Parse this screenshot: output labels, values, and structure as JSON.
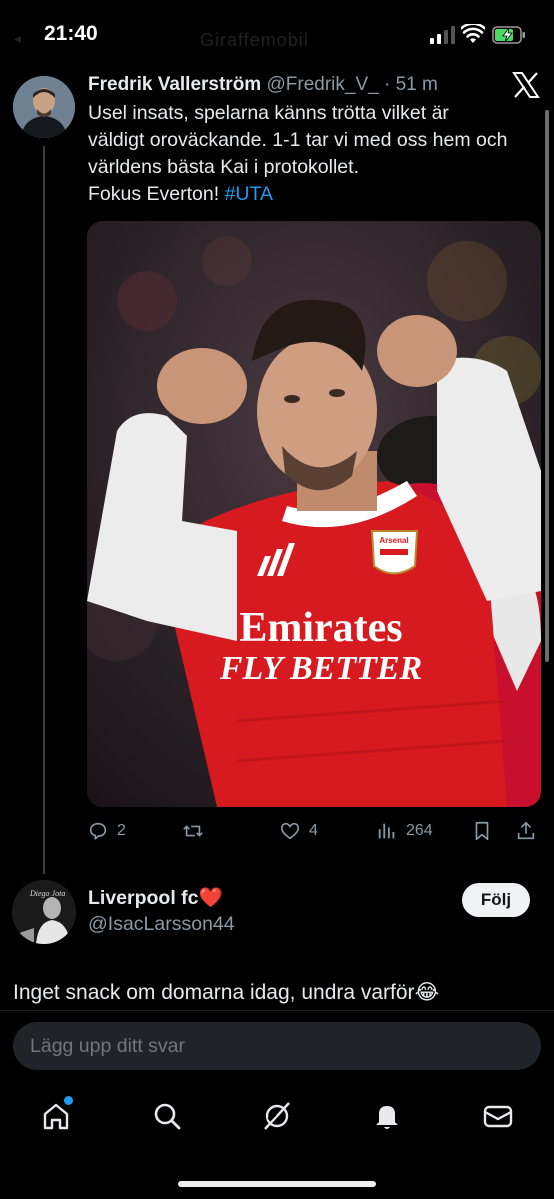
{
  "status_bar": {
    "time": "21:40",
    "ghost_title": "Giraffemobil"
  },
  "tweet": {
    "author_name": "Fredrik Vallerström",
    "author_handle": "@Fredrik_V_",
    "separator": " · ",
    "time_ago": "51 m",
    "text_lines": [
      "Usel insats, spelarna känns trötta vilket är",
      "väldigt oroväckande. 1-1 tar vi med oss hem och",
      "världens bästa Kai i protokollet.",
      "Fokus Everton! "
    ],
    "hashtag": "#UTA",
    "media": {
      "jersey_sponsor_line1": "Emirates",
      "jersey_sponsor_line2": "FLY BETTER",
      "crest_text": "Arsenal"
    },
    "actions": {
      "replies": "2",
      "retweets": "",
      "likes": "4",
      "views": "264"
    }
  },
  "reply": {
    "author_name": "Liverpool fc",
    "author_emoji": "❤️",
    "author_handle": "@IsacLarsson44",
    "avatar_caption": "Diego Jota",
    "follow_label": "Följ",
    "text": "Inget snack om domarna idag, undra varför",
    "text_emoji": "😂"
  },
  "compose": {
    "placeholder": "Lägg upp ditt svar"
  },
  "tabbar": {
    "items": [
      "home-icon",
      "search-icon",
      "grok-icon",
      "notifications-icon",
      "messages-icon"
    ]
  },
  "colors": {
    "background": "#000000",
    "text": "#e7e9ea",
    "muted": "#8b98a5",
    "accent": "#1d9bf0",
    "heart": "#e0245e"
  }
}
